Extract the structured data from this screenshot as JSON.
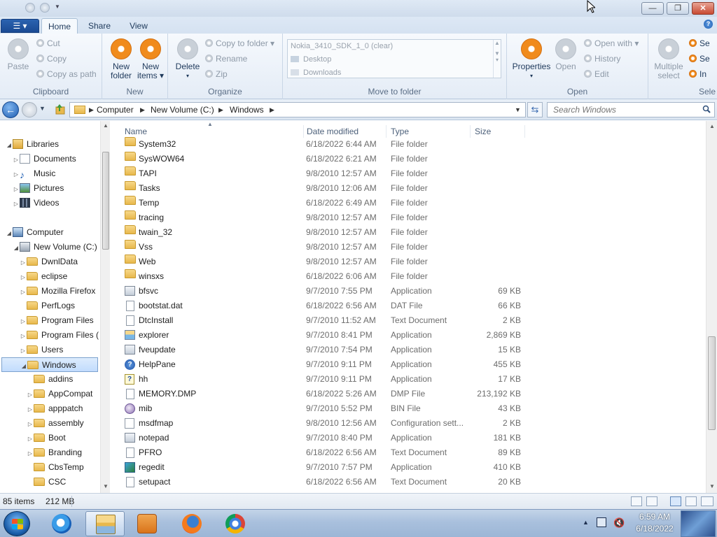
{
  "window": {
    "caption_buttons": {
      "minimize": "—",
      "maximize": "❐",
      "close": "✕"
    }
  },
  "ribbon": {
    "file_tab_icon": "menu-icon",
    "tabs": [
      "Home",
      "Share",
      "View"
    ],
    "active_tab": "Home",
    "clipboard": {
      "label": "Clipboard",
      "paste": "Paste",
      "cut": "Cut",
      "copy": "Copy",
      "copy_as_path": "Copy as path"
    },
    "new": {
      "label": "New",
      "new_folder_line1": "New",
      "new_folder_line2": "folder",
      "new_items_line1": "New",
      "new_items_line2": "items ▾"
    },
    "organize": {
      "label": "Organize",
      "delete": "Delete",
      "copy_to_folder": "Copy to folder ▾",
      "rename": "Rename",
      "zip": "Zip"
    },
    "move_to": {
      "label": "Move to folder",
      "items": [
        "Nokia_3410_SDK_1_0 (clear)",
        "Desktop",
        "Downloads"
      ]
    },
    "open": {
      "label": "Open",
      "properties": "Properties",
      "open": "Open",
      "open_with": "Open with ▾",
      "history": "History",
      "edit": "Edit"
    },
    "select": {
      "label": "Sele",
      "multiple_line1": "Multiple",
      "multiple_line2": "select",
      "s1": "Se",
      "s2": "Se",
      "s3": "In"
    }
  },
  "address": {
    "crumbs": [
      "Computer",
      "New Volume (C:)",
      "Windows"
    ],
    "search_placeholder": "Search Windows"
  },
  "nav": {
    "items": [
      {
        "label": "Libraries",
        "icon": "libraries-icon"
      },
      {
        "label": "Documents",
        "icon": "documents-icon"
      },
      {
        "label": "Music",
        "icon": "music-icon"
      },
      {
        "label": "Pictures",
        "icon": "pictures-icon"
      },
      {
        "label": "Videos",
        "icon": "videos-icon"
      },
      {
        "label": "Computer",
        "icon": "computer-icon"
      },
      {
        "label": "New Volume (C:)",
        "icon": "drive-icon"
      },
      {
        "label": "DwnlData"
      },
      {
        "label": "eclipse"
      },
      {
        "label": "Mozilla Firefox"
      },
      {
        "label": "PerfLogs"
      },
      {
        "label": "Program Files"
      },
      {
        "label": "Program Files ("
      },
      {
        "label": "Users"
      },
      {
        "label": "Windows"
      },
      {
        "label": "addins"
      },
      {
        "label": "AppCompat"
      },
      {
        "label": "apppatch"
      },
      {
        "label": "assembly"
      },
      {
        "label": "Boot"
      },
      {
        "label": "Branding"
      },
      {
        "label": "CbsTemp"
      },
      {
        "label": "CSC"
      }
    ]
  },
  "files": {
    "columns": [
      "Name",
      "Date modified",
      "Type",
      "Size"
    ],
    "rows": [
      {
        "name": "System32",
        "date": "6/18/2022 6:44 AM",
        "type": "File folder",
        "size": "",
        "icon": "folder"
      },
      {
        "name": "SysWOW64",
        "date": "6/18/2022 6:21 AM",
        "type": "File folder",
        "size": "",
        "icon": "folder"
      },
      {
        "name": "TAPI",
        "date": "9/8/2010 12:57 AM",
        "type": "File folder",
        "size": "",
        "icon": "folder"
      },
      {
        "name": "Tasks",
        "date": "9/8/2010 12:06 AM",
        "type": "File folder",
        "size": "",
        "icon": "folder"
      },
      {
        "name": "Temp",
        "date": "6/18/2022 6:49 AM",
        "type": "File folder",
        "size": "",
        "icon": "folder"
      },
      {
        "name": "tracing",
        "date": "9/8/2010 12:57 AM",
        "type": "File folder",
        "size": "",
        "icon": "folder"
      },
      {
        "name": "twain_32",
        "date": "9/8/2010 12:57 AM",
        "type": "File folder",
        "size": "",
        "icon": "folder"
      },
      {
        "name": "Vss",
        "date": "9/8/2010 12:57 AM",
        "type": "File folder",
        "size": "",
        "icon": "folder"
      },
      {
        "name": "Web",
        "date": "9/8/2010 12:57 AM",
        "type": "File folder",
        "size": "",
        "icon": "folder"
      },
      {
        "name": "winsxs",
        "date": "6/18/2022 6:06 AM",
        "type": "File folder",
        "size": "",
        "icon": "folder"
      },
      {
        "name": "bfsvc",
        "date": "9/7/2010 7:55 PM",
        "type": "Application",
        "size": "69 KB",
        "icon": "app"
      },
      {
        "name": "bootstat.dat",
        "date": "6/18/2022 6:56 AM",
        "type": "DAT File",
        "size": "66 KB",
        "icon": "doc"
      },
      {
        "name": "DtcInstall",
        "date": "9/7/2010 11:52 AM",
        "type": "Text Document",
        "size": "2 KB",
        "icon": "doc"
      },
      {
        "name": "explorer",
        "date": "9/7/2010 8:41 PM",
        "type": "Application",
        "size": "2,869 KB",
        "icon": "explorer"
      },
      {
        "name": "fveupdate",
        "date": "9/7/2010 7:54 PM",
        "type": "Application",
        "size": "15 KB",
        "icon": "app"
      },
      {
        "name": "HelpPane",
        "date": "9/7/2010 9:11 PM",
        "type": "Application",
        "size": "455 KB",
        "icon": "help"
      },
      {
        "name": "hh",
        "date": "9/7/2010 9:11 PM",
        "type": "Application",
        "size": "17 KB",
        "icon": "hh"
      },
      {
        "name": "MEMORY.DMP",
        "date": "6/18/2022 5:26 AM",
        "type": "DMP File",
        "size": "213,192 KB",
        "icon": "doc"
      },
      {
        "name": "mib",
        "date": "9/7/2010 5:52 PM",
        "type": "BIN File",
        "size": "43 KB",
        "icon": "bin"
      },
      {
        "name": "msdfmap",
        "date": "9/8/2010 12:56 AM",
        "type": "Configuration sett...",
        "size": "2 KB",
        "icon": "cfg"
      },
      {
        "name": "notepad",
        "date": "9/7/2010 8:40 PM",
        "type": "Application",
        "size": "181 KB",
        "icon": "app"
      },
      {
        "name": "PFRO",
        "date": "6/18/2022 6:56 AM",
        "type": "Text Document",
        "size": "89 KB",
        "icon": "doc"
      },
      {
        "name": "regedit",
        "date": "9/7/2010 7:57 PM",
        "type": "Application",
        "size": "410 KB",
        "icon": "reg"
      },
      {
        "name": "setupact",
        "date": "6/18/2022 6:56 AM",
        "type": "Text Document",
        "size": "20 KB",
        "icon": "doc"
      }
    ]
  },
  "status": {
    "item_count": "85 items",
    "total_size": "212 MB"
  },
  "taskbar": {
    "apps": [
      "internet-explorer-icon",
      "windows-explorer-icon",
      "media-center-icon",
      "firefox-icon",
      "chrome-icon"
    ],
    "time": "6:59 AM",
    "date": "6/18/2022"
  }
}
